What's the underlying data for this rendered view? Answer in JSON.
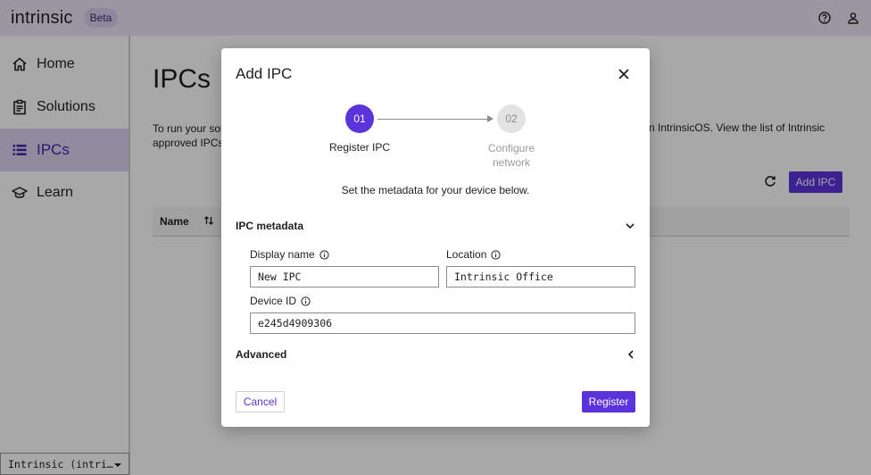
{
  "app": {
    "brand": "intrinsic",
    "badge": "Beta"
  },
  "sidebar": {
    "items": [
      {
        "label": "Home",
        "icon": "home-icon"
      },
      {
        "label": "Solutions",
        "icon": "clipboard-icon"
      },
      {
        "label": "IPCs",
        "icon": "list-icon",
        "active": true
      },
      {
        "label": "Learn",
        "icon": "graduation-cap-icon"
      }
    ],
    "org_select": "Intrinsic (intri…"
  },
  "main": {
    "title": "IPCs",
    "intro_left_line1": "To run your sol",
    "intro_left_line2": "approved IPCs",
    "intro_right": "n IntrinsicOS. View the list of Intrinsic",
    "add_button": "Add IPC",
    "table_headers": [
      "Name"
    ]
  },
  "modal": {
    "title": "Add IPC",
    "steps": [
      {
        "number": "01",
        "label": "Register IPC",
        "active": true
      },
      {
        "number": "02",
        "label_line1": "Configure",
        "label_line2": "network",
        "active": false
      }
    ],
    "subtitle": "Set the metadata for your device below.",
    "metadata_section": "IPC metadata",
    "fields": {
      "display_name": {
        "label": "Display name",
        "value": "New IPC"
      },
      "location": {
        "label": "Location",
        "value": "Intrinsic Office"
      },
      "device_id": {
        "label": "Device ID",
        "value": "e245d4909306"
      }
    },
    "advanced_section": "Advanced",
    "cancel_label": "Cancel",
    "register_label": "Register"
  },
  "colors": {
    "accent": "#5b33db",
    "topbar_bg": "#ece6f5",
    "active_nav_bg": "#dcd2f0"
  }
}
